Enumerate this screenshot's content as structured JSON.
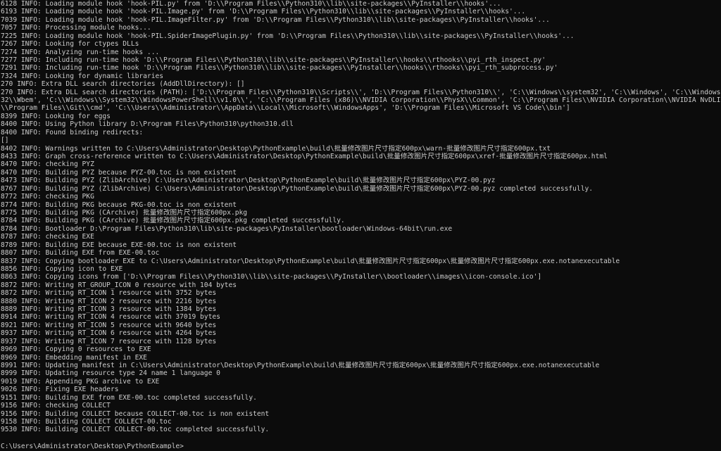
{
  "window": {
    "background": "#0c0c0c",
    "text_color": "#cccccc"
  },
  "console": {
    "lines": [
      "6128 INFO: Loading module hook 'hook-PIL.py' from 'D:\\\\Program Files\\\\Python310\\\\lib\\\\site-packages\\\\PyInstaller\\\\hooks'...",
      "6193 INFO: Loading module hook 'hook-PIL.Image.py' from 'D:\\\\Program Files\\\\Python310\\\\lib\\\\site-packages\\\\PyInstaller\\\\hooks'...",
      "7039 INFO: Loading module hook 'hook-PIL.ImageFilter.py' from 'D:\\\\Program Files\\\\Python310\\\\lib\\\\site-packages\\\\PyInstaller\\\\hooks'...",
      "7057 INFO: Processing module hooks...",
      "7225 INFO: Loading module hook 'hook-PIL.SpiderImagePlugin.py' from 'D:\\\\Program Files\\\\Python310\\\\lib\\\\site-packages\\\\PyInstaller\\\\hooks'...",
      "7267 INFO: Looking for ctypes DLLs",
      "7274 INFO: Analyzing run-time hooks ...",
      "7277 INFO: Including run-time hook 'D:\\\\Program Files\\\\Python310\\\\lib\\\\site-packages\\\\PyInstaller\\\\hooks\\\\rthooks\\\\pyi_rth_inspect.py'",
      "7291 INFO: Including run-time hook 'D:\\\\Program Files\\\\Python310\\\\lib\\\\site-packages\\\\PyInstaller\\\\hooks\\\\rthooks\\\\pyi_rth_subprocess.py'",
      "7324 INFO: Looking for dynamic libraries",
      "270 INFO: Extra DLL search directories (AddDllDirectory): []",
      "270 INFO: Extra DLL search directories (PATH): ['D:\\\\Program Files\\\\Python310\\\\Scripts\\\\', 'D:\\\\Program Files\\\\Python310\\\\', 'C:\\\\Windows\\\\system32', 'C:\\\\Windows', 'C:\\\\Windows\\\\System",
      "32\\\\Wbem', 'C:\\\\Windows\\\\System32\\\\WindowsPowerShell\\\\v1.0\\\\', 'C:\\\\Program Files (x86)\\\\NVIDIA Corporation\\\\PhysX\\\\Common', 'C:\\\\Program Files\\\\NVIDIA Corporation\\\\NVIDIA NvDLISR', 'C:",
      "\\\\Program Files\\\\Git\\\\cmd', 'C:\\\\Users\\\\Administrator\\\\AppData\\\\Local\\\\Microsoft\\\\WindowsApps', 'D:\\\\Program Files\\\\Microsoft VS Code\\\\bin']",
      "8399 INFO: Looking for eggs",
      "8400 INFO: Using Python library D:\\Program Files\\Python310\\python310.dll",
      "8400 INFO: Found binding redirects:",
      "[]",
      "8402 INFO: Warnings written to C:\\Users\\Administrator\\Desktop\\PythonExample\\build\\批量修改图片尺寸指定600px\\warn-批量修改图片尺寸指定600px.txt",
      "8433 INFO: Graph cross-reference written to C:\\Users\\Administrator\\Desktop\\PythonExample\\build\\批量修改图片尺寸指定600px\\xref-批量修改图片尺寸指定600px.html",
      "8470 INFO: checking PYZ",
      "8470 INFO: Building PYZ because PYZ-00.toc is non existent",
      "8473 INFO: Building PYZ (ZlibArchive) C:\\Users\\Administrator\\Desktop\\PythonExample\\build\\批量修改图片尺寸指定600px\\PYZ-00.pyz",
      "8767 INFO: Building PYZ (ZlibArchive) C:\\Users\\Administrator\\Desktop\\PythonExample\\build\\批量修改图片尺寸指定600px\\PYZ-00.pyz completed successfully.",
      "8772 INFO: checking PKG",
      "8774 INFO: Building PKG because PKG-00.toc is non existent",
      "8775 INFO: Building PKG (CArchive) 批量修改图片尺寸指定600px.pkg",
      "8784 INFO: Building PKG (CArchive) 批量修改图片尺寸指定600px.pkg completed successfully.",
      "8784 INFO: Bootloader D:\\Program Files\\Python310\\lib\\site-packages\\PyInstaller\\bootloader\\Windows-64bit\\run.exe",
      "8787 INFO: checking EXE",
      "8789 INFO: Building EXE because EXE-00.toc is non existent",
      "8807 INFO: Building EXE from EXE-00.toc",
      "8837 INFO: Copying bootloader EXE to C:\\Users\\Administrator\\Desktop\\PythonExample\\build\\批量修改图片尺寸指定600px\\批量修改图片尺寸指定600px.exe.notanexecutable",
      "8856 INFO: Copying icon to EXE",
      "8863 INFO: Copying icons from ['D:\\\\Program Files\\\\Python310\\\\lib\\\\site-packages\\\\PyInstaller\\\\bootloader\\\\images\\\\icon-console.ico']",
      "8872 INFO: Writing RT_GROUP_ICON 0 resource with 104 bytes",
      "8872 INFO: Writing RT_ICON 1 resource with 3752 bytes",
      "8880 INFO: Writing RT_ICON 2 resource with 2216 bytes",
      "8889 INFO: Writing RT_ICON 3 resource with 1384 bytes",
      "8914 INFO: Writing RT_ICON 4 resource with 37019 bytes",
      "8921 INFO: Writing RT_ICON 5 resource with 9640 bytes",
      "8937 INFO: Writing RT_ICON 6 resource with 4264 bytes",
      "8937 INFO: Writing RT_ICON 7 resource with 1128 bytes",
      "8969 INFO: Copying 0 resources to EXE",
      "8969 INFO: Embedding manifest in EXE",
      "8991 INFO: Updating manifest in C:\\Users\\Administrator\\Desktop\\PythonExample\\build\\批量修改图片尺寸指定600px\\批量修改图片尺寸指定600px.exe.notanexecutable",
      "8999 INFO: Updating resource type 24 name 1 language 0",
      "9019 INFO: Appending PKG archive to EXE",
      "9026 INFO: Fixing EXE headers",
      "9151 INFO: Building EXE from EXE-00.toc completed successfully.",
      "9156 INFO: checking COLLECT",
      "9156 INFO: Building COLLECT because COLLECT-00.toc is non existent",
      "9158 INFO: Building COLLECT COLLECT-00.toc",
      "9530 INFO: Building COLLECT COLLECT-00.toc completed successfully."
    ],
    "prompt": "C:\\Users\\Administrator\\Desktop\\PythonExample>"
  }
}
